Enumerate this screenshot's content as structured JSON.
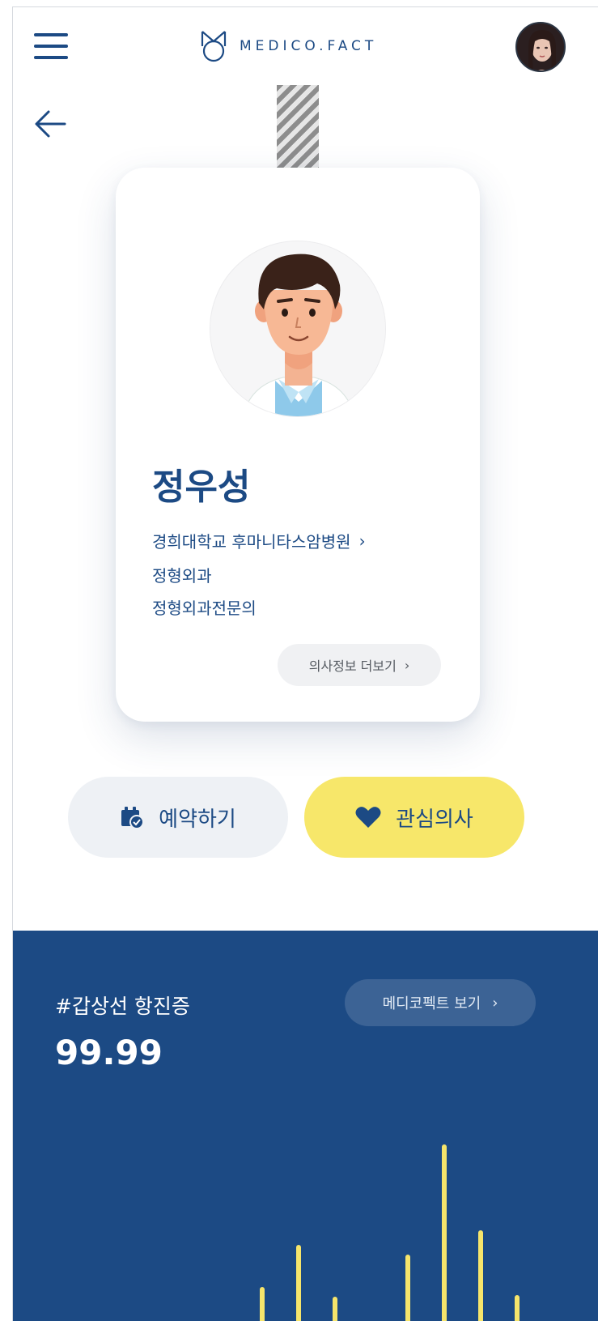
{
  "header": {
    "logo_text": "MEDICO.FACT"
  },
  "card": {
    "name": "정우성",
    "hospital": "경희대학교 후마니타스암병원",
    "department": "정형외과",
    "specialty": "정형외과전문의",
    "more_label": "의사정보 더보기"
  },
  "actions": {
    "reserve_label": "예약하기",
    "favorite_label": "관심의사"
  },
  "stats": {
    "tag": "#갑상선 항진증",
    "value": "99.99",
    "view_label": "메디코펙트 보기"
  },
  "colors": {
    "primary": "#1c4a84",
    "accent_yellow": "#f7e76a",
    "bar": "#f6e56b"
  },
  "chart_data": {
    "type": "bar",
    "values": [
      12,
      60,
      112,
      48,
      8,
      100,
      236,
      130,
      50
    ]
  }
}
